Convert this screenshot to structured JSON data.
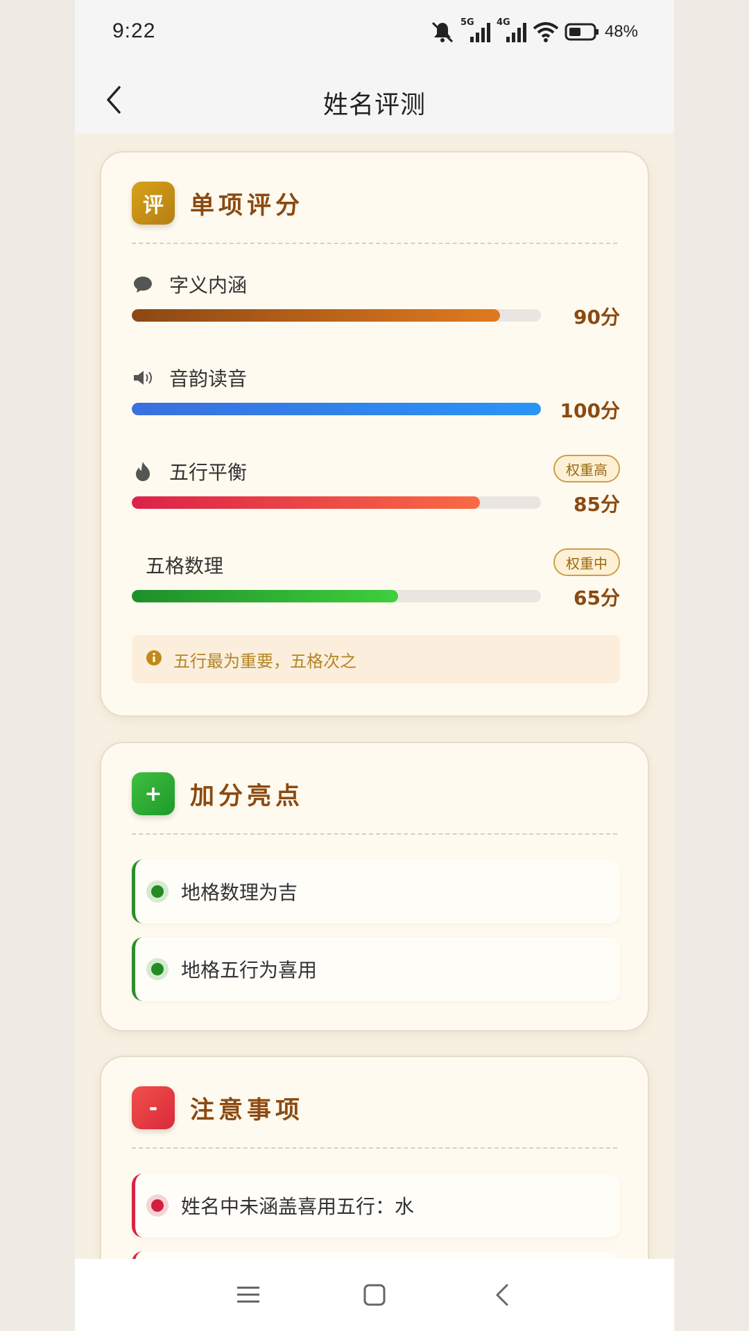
{
  "status_bar": {
    "time": "9:22",
    "network_5g": "5G",
    "network_4g": "4G",
    "battery": "48%"
  },
  "header": {
    "title": "姓名评测"
  },
  "scores_card": {
    "badge": "评",
    "title": "单项评分",
    "items": [
      {
        "label": "字义内涵",
        "icon": "chat-bubble-icon",
        "score": 90,
        "score_text": "90分",
        "weight": ""
      },
      {
        "label": "音韵读音",
        "icon": "speaker-icon",
        "score": 100,
        "score_text": "100分",
        "weight": ""
      },
      {
        "label": "五行平衡",
        "icon": "flame-icon",
        "score": 85,
        "score_text": "85分",
        "weight": "权重高"
      },
      {
        "label": "五格数理",
        "icon": "",
        "score": 65,
        "score_text": "65分",
        "weight": "权重中"
      }
    ],
    "tip": "五行最为重要，五格次之"
  },
  "bonus_card": {
    "badge": "+",
    "title": "加分亮点",
    "items": [
      "地格数理为吉",
      "地格五行为喜用"
    ]
  },
  "notice_card": {
    "badge": "-",
    "title": "注意事项",
    "items": [
      "姓名中未涵盖喜用五行：水"
    ]
  },
  "colors": {
    "accent": "#8a4a12",
    "gold": "#c9a04a",
    "green": "#2c8f2c",
    "red": "#d62449",
    "blue": "#2a95f5"
  }
}
